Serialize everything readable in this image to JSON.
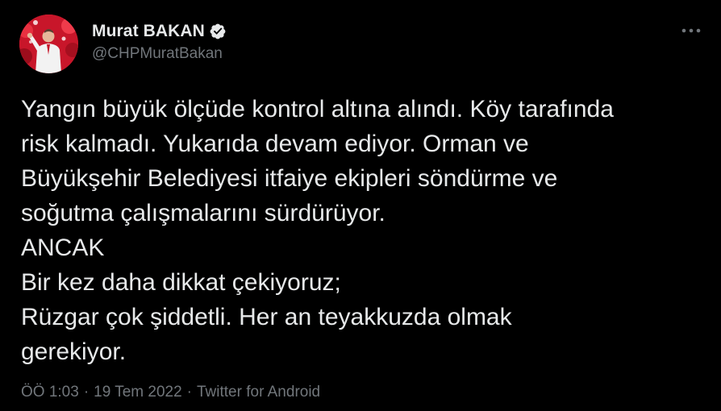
{
  "author": {
    "display_name": "Murat BAKAN",
    "handle": "@CHPMuratBakan",
    "verified": true,
    "avatar_icon": "profile-photo"
  },
  "menu": {
    "icon": "more-horizontal-icon"
  },
  "tweet": {
    "lines": [
      "Yangın büyük ölçüde kontrol altına alındı. Köy tarafında",
      "risk kalmadı. Yukarıda devam ediyor. Orman ve",
      "Büyükşehir Belediyesi itfaiye ekipleri söndürme ve",
      "soğutma çalışmalarını sürdürüyor.",
      "ANCAK",
      "Bir kez daha dikkat çekiyoruz;",
      "Rüzgar çok şiddetli. Her an teyakkuzda olmak",
      "gerekiyor."
    ]
  },
  "meta": {
    "time": "ÖÖ 1:03",
    "date": "19 Tem 2022",
    "separator": "·",
    "source": "Twitter for Android"
  },
  "colors": {
    "background": "#000000",
    "text": "#e7e9ea",
    "secondary": "#71767b",
    "verified_badge": "#e7e9ea"
  }
}
